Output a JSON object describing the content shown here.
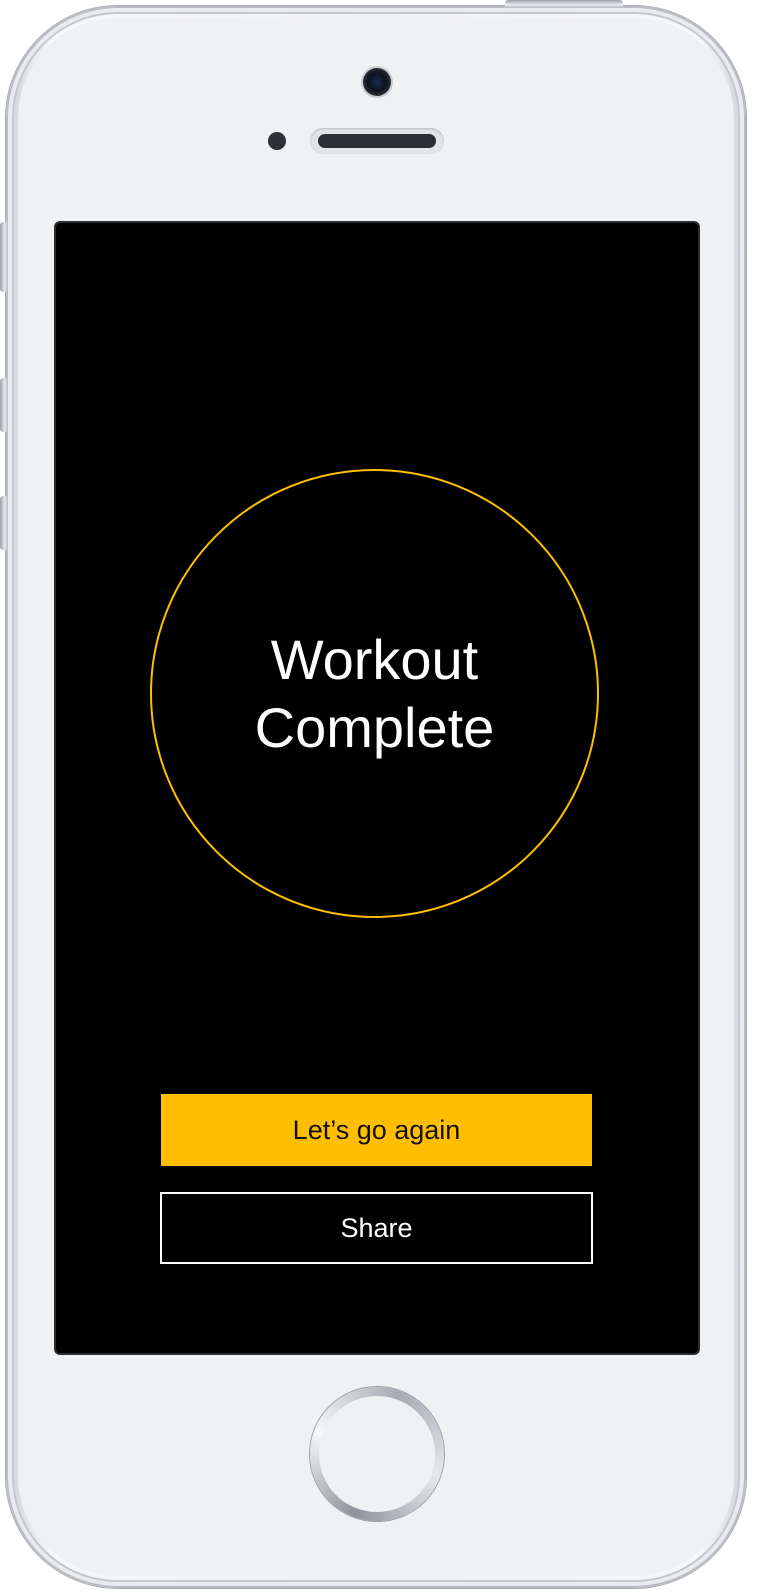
{
  "device": {
    "type": "iPhone",
    "frame_color": "#f0f1f3",
    "screen_color": "#000000"
  },
  "screen": {
    "status": {
      "title_line1": "Workout",
      "title_line2": "Complete",
      "ring_color": "#ffbf00"
    },
    "actions": {
      "primary_label": "Let’s go again",
      "primary_color": "#ffbf00",
      "secondary_label": "Share"
    }
  },
  "icons": {
    "camera": "front-camera-icon",
    "sensor": "proximity-sensor-icon",
    "speaker": "earpiece-speaker-icon",
    "home": "home-button"
  }
}
